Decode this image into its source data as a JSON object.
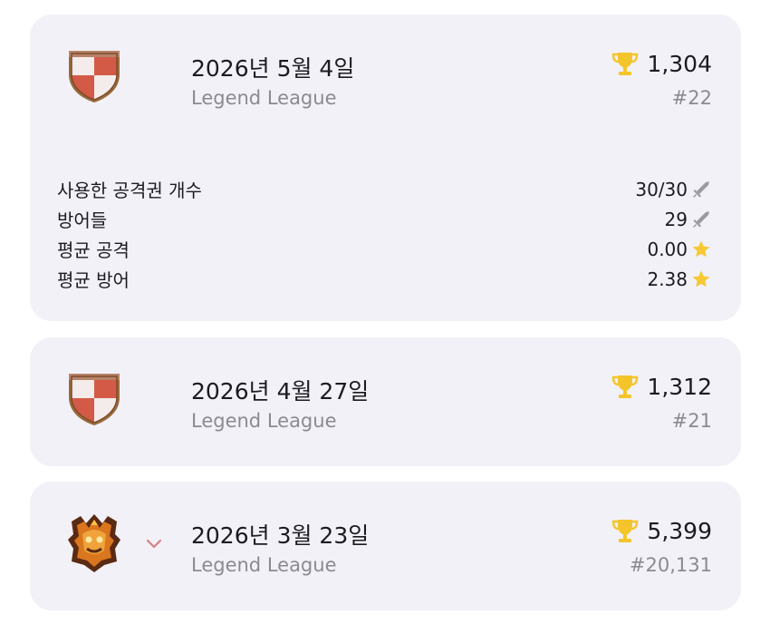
{
  "seasons": [
    {
      "date": "2026년 5월 4일",
      "league": "Legend League",
      "trophies": "1,304",
      "rank": "#22",
      "badge": "shield-badge",
      "stats": [
        {
          "label": "사용한 공격권 개수",
          "value": "30/30",
          "icon": "sword-icon"
        },
        {
          "label": "방어들",
          "value": "29",
          "icon": "sword-icon"
        },
        {
          "label": "평균 공격",
          "value": "0.00",
          "icon": "star-icon"
        },
        {
          "label": "평균 방어",
          "value": "2.38",
          "icon": "star-icon"
        }
      ]
    },
    {
      "date": "2026년 4월 27일",
      "league": "Legend League",
      "trophies": "1,312",
      "rank": "#21",
      "badge": "shield-badge"
    },
    {
      "date": "2026년 3월 23일",
      "league": "Legend League",
      "trophies": "5,399",
      "rank": "#20,131",
      "badge": "legend-league-badge",
      "expand_icon": "chevron-down-icon"
    }
  ],
  "colors": {
    "card_bg": "#f2f1f7",
    "text_primary": "#1c1b20",
    "text_secondary": "#8b8a91",
    "trophy": "#f4c52b",
    "star": "#f6c834",
    "sword": "#9a9aa0",
    "chevron": "#d77f86"
  }
}
